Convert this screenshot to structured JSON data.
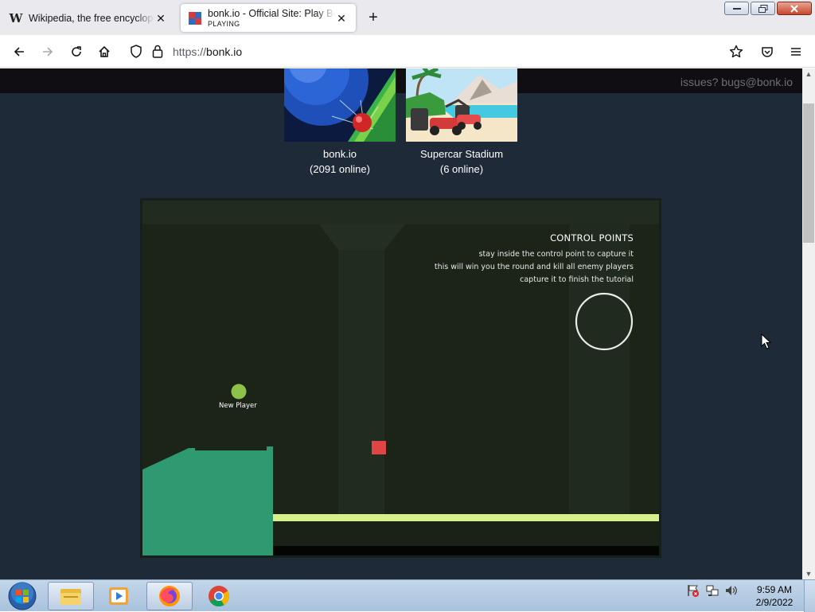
{
  "browser": {
    "tabs": [
      {
        "title": "Wikipedia, the free encyclopedia",
        "favicon": "wikipedia-w-icon"
      },
      {
        "title": "bonk.io - Official Site: Play Bonk",
        "subtitle": "PLAYING",
        "favicon": "bonk-favicon"
      }
    ],
    "url": {
      "protocol": "https://",
      "host": "bonk.io"
    }
  },
  "page": {
    "contact": "issues? bugs@bonk.io",
    "games": [
      {
        "name": "bonk.io",
        "online": "(2091 online)"
      },
      {
        "name": "Supercar Stadium",
        "online": "(6 online)"
      }
    ],
    "tutorial": {
      "heading": "CONTROL POINTS",
      "lines": [
        "stay inside the control point to capture it",
        "this will win you the round and kill all enemy players",
        "capture it to finish the tutorial"
      ],
      "player_name": "New Player"
    }
  },
  "taskbar": {
    "time": "9:59 AM",
    "date": "2/9/2022"
  },
  "colors": {
    "page_bg": "#1e2a38",
    "game_bg": "#1c2418",
    "platform_green": "#2f9a72",
    "floor_yellow": "#d6f08a",
    "player_green": "#8cc24a",
    "box_red": "#e04545"
  }
}
